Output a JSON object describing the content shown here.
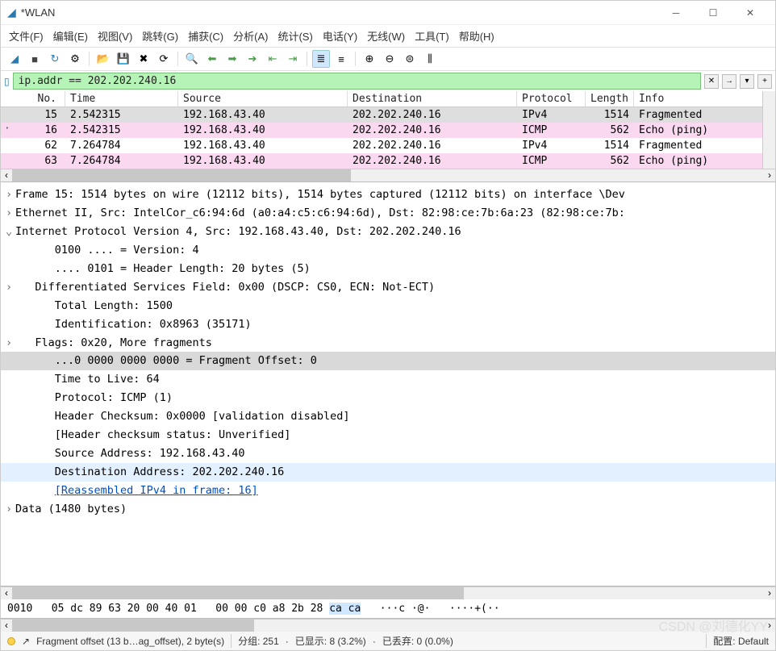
{
  "window": {
    "title": "*WLAN"
  },
  "menu": [
    "文件(F)",
    "编辑(E)",
    "视图(V)",
    "跳转(G)",
    "捕获(C)",
    "分析(A)",
    "统计(S)",
    "电话(Y)",
    "无线(W)",
    "工具(T)",
    "帮助(H)"
  ],
  "filter": {
    "value": "ip.addr == 202.202.240.16"
  },
  "columns": {
    "no": "No.",
    "time": "Time",
    "src": "Source",
    "dst": "Destination",
    "proto": "Protocol",
    "len": "Length",
    "info": "Info"
  },
  "packets": [
    {
      "no": "15",
      "time": "2.542315",
      "src": "192.168.43.40",
      "dst": "202.202.240.16",
      "proto": "IPv4",
      "len": "1514",
      "info": "Fragmented",
      "cls": "row-gray"
    },
    {
      "no": "16",
      "time": "2.542315",
      "src": "192.168.43.40",
      "dst": "202.202.240.16",
      "proto": "ICMP",
      "len": "562",
      "info": "Echo (ping)",
      "cls": "row-pink",
      "dot": true
    },
    {
      "no": "62",
      "time": "7.264784",
      "src": "192.168.43.40",
      "dst": "202.202.240.16",
      "proto": "IPv4",
      "len": "1514",
      "info": "Fragmented",
      "cls": "row-white"
    },
    {
      "no": "63",
      "time": "7.264784",
      "src": "192.168.43.40",
      "dst": "202.202.240.16",
      "proto": "ICMP",
      "len": "562",
      "info": "Echo (ping)",
      "cls": "row-pink"
    }
  ],
  "details": [
    {
      "exp": ">",
      "ind": 0,
      "text": "Frame 15: 1514 bytes on wire (12112 bits), 1514 bytes captured (12112 bits) on interface \\Dev"
    },
    {
      "exp": ">",
      "ind": 0,
      "text": "Ethernet II, Src: IntelCor_c6:94:6d (a0:a4:c5:c6:94:6d), Dst: 82:98:ce:7b:6a:23 (82:98:ce:7b:"
    },
    {
      "exp": "v",
      "ind": 0,
      "text": "Internet Protocol Version 4, Src: 192.168.43.40, Dst: 202.202.240.16"
    },
    {
      "exp": "",
      "ind": 2,
      "text": "0100 .... = Version: 4"
    },
    {
      "exp": "",
      "ind": 2,
      "text": ".... 0101 = Header Length: 20 bytes (5)"
    },
    {
      "exp": ">",
      "ind": 1,
      "text": "Differentiated Services Field: 0x00 (DSCP: CS0, ECN: Not-ECT)"
    },
    {
      "exp": "",
      "ind": 2,
      "text": "Total Length: 1500"
    },
    {
      "exp": "",
      "ind": 2,
      "text": "Identification: 0x8963 (35171)"
    },
    {
      "exp": ">",
      "ind": 1,
      "text": "Flags: 0x20, More fragments"
    },
    {
      "exp": "",
      "ind": 2,
      "text": "...0 0000 0000 0000 = Fragment Offset: 0",
      "cls": "sel-gray"
    },
    {
      "exp": "",
      "ind": 2,
      "text": "Time to Live: 64"
    },
    {
      "exp": "",
      "ind": 2,
      "text": "Protocol: ICMP (1)"
    },
    {
      "exp": "",
      "ind": 2,
      "text": "Header Checksum: 0x0000 [validation disabled]"
    },
    {
      "exp": "",
      "ind": 2,
      "text": "[Header checksum status: Unverified]"
    },
    {
      "exp": "",
      "ind": 2,
      "text": "Source Address: 192.168.43.40"
    },
    {
      "exp": "",
      "ind": 2,
      "text": "Destination Address: 202.202.240.16",
      "cls": "sel-blue"
    },
    {
      "exp": "",
      "ind": 2,
      "text": "[Reassembled IPv4 in frame: 16]",
      "link": true
    },
    {
      "exp": ">",
      "ind": 0,
      "text": "Data (1480 bytes)"
    }
  ],
  "bytes": {
    "offset": "0010",
    "hex1": "05 dc 89 63 20 00 40 01",
    "hex2": "00 00 c0 a8 2b 28 ",
    "hex2_hl": "ca ca",
    "ascii": "   ···c ·@·   ····+(··"
  },
  "status": {
    "field": "Fragment offset (13 b…ag_offset), 2 byte(s)",
    "pkts": "分组: 251",
    "disp": "已显示: 8 (3.2%)",
    "drop": "已丢弃: 0 (0.0%)",
    "profile": "配置: Default"
  }
}
